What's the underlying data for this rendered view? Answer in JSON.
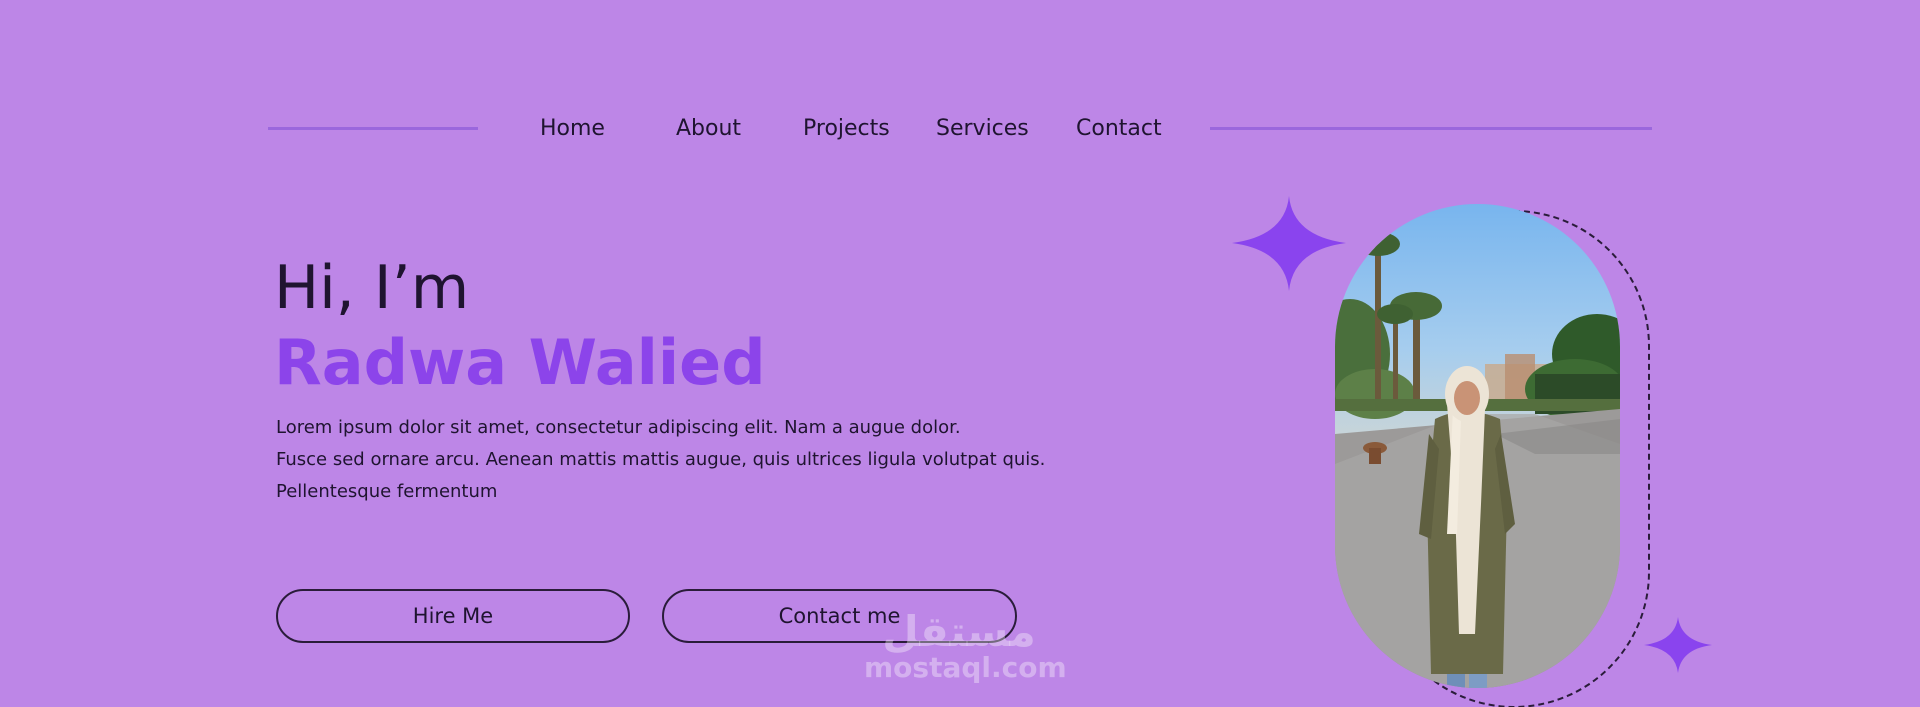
{
  "nav": {
    "items": [
      "Home",
      "About",
      "Projects",
      "Services",
      "Contact"
    ]
  },
  "hero": {
    "greeting": "Hi, I’m",
    "name": "Radwa Walied",
    "description_lines": [
      "Lorem ipsum dolor sit amet, consectetur adipiscing elit. Nam a augue dolor.",
      "Fusce sed ornare arcu. Aenean mattis mattis augue, quis ultrices ligula volutpat quis.",
      "Pellentesque fermentum"
    ]
  },
  "buttons": {
    "hire": "Hire Me",
    "contact": "Contact me"
  },
  "watermark": {
    "arabic": "مستقل",
    "latin": "mostaql.com"
  },
  "colors": {
    "background": "#bd86e7",
    "accent": "#8c44ea",
    "text": "#1f1430",
    "sparkle": "#8a44ee"
  },
  "icons": {
    "large_sparkle": "four-point-star-icon",
    "small_sparkle": "four-point-star-icon"
  }
}
